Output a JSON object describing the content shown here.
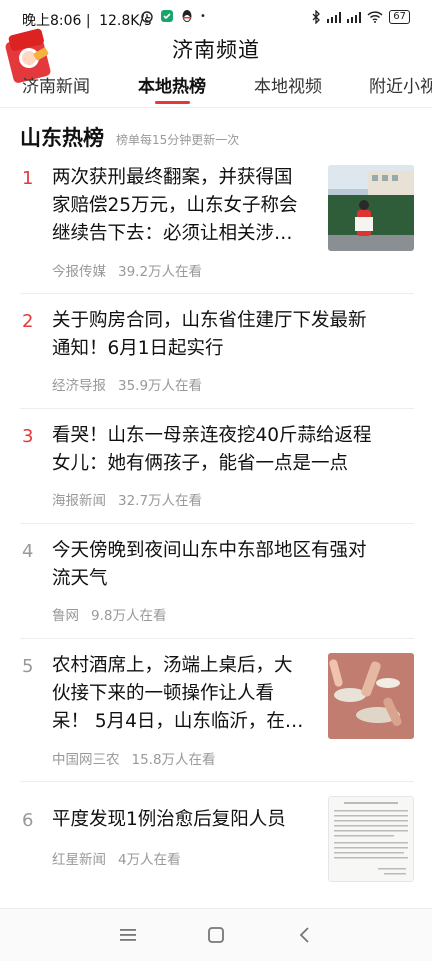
{
  "status_bar": {
    "time": "晚上8:06",
    "network_speed": "12.8K/s",
    "battery": "67",
    "icons": [
      "alarm-icon",
      "shield-app-icon",
      "qq-penguin-icon",
      "dot-icon",
      "bluetooth-icon",
      "hd-signal-icon",
      "hd-signal-icon",
      "wifi-icon",
      "battery-icon"
    ]
  },
  "header": {
    "title": "济南频道"
  },
  "tabs": [
    {
      "label": "济南新闻",
      "active": false
    },
    {
      "label": "本地热榜",
      "active": true
    },
    {
      "label": "本地视频",
      "active": false
    },
    {
      "label": "附近小视",
      "active": false
    }
  ],
  "section": {
    "title": "山东热榜",
    "subtitle": "榜单每15分钟更新一次"
  },
  "items": [
    {
      "rank": "1",
      "title_lines": [
        "两次获刑最终翻案，并获得国",
        "家赔偿25万元，山东女子称会",
        "继续告下去：必须让相关涉…"
      ],
      "source": "今报传媒",
      "views": "39.2万人在看",
      "has_thumb": true
    },
    {
      "rank": "2",
      "title_lines": [
        "关于购房合同，山东省住建厅下发最新",
        "通知！6月1日起实行"
      ],
      "source": "经济导报",
      "views": "35.9万人在看",
      "has_thumb": false
    },
    {
      "rank": "3",
      "title_lines": [
        "看哭！山东一母亲连夜挖40斤蒜给返程",
        "女儿：她有俩孩子，能省一点是一点"
      ],
      "source": "海报新闻",
      "views": "32.7万人在看",
      "has_thumb": false
    },
    {
      "rank": "4",
      "title_lines": [
        "今天傍晚到夜间山东中东部地区有强对",
        "流天气"
      ],
      "source": "鲁网",
      "views": "9.8万人在看",
      "has_thumb": false
    },
    {
      "rank": "5",
      "title_lines": [
        "农村酒席上，汤端上桌后，大",
        "伙接下来的一顿操作让人看",
        "呆！ 5月4日，山东临沂，在…"
      ],
      "source": "中国网三农",
      "views": "15.8万人在看",
      "has_thumb": true
    },
    {
      "rank": "6",
      "title_lines": [
        "平度发现1例治愈后复阳人员"
      ],
      "source": "红星新闻",
      "views": "4万人在看",
      "has_thumb": true
    }
  ],
  "colors": {
    "accent": "#e4393c",
    "muted": "#999999"
  }
}
